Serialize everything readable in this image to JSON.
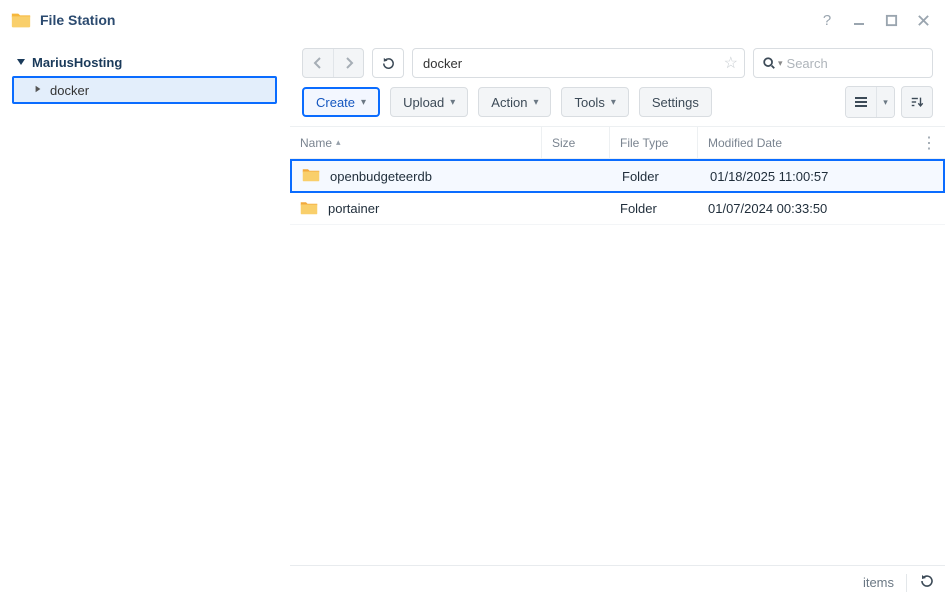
{
  "app": {
    "title": "File Station"
  },
  "sidebar": {
    "root": "MariusHosting",
    "items": [
      {
        "label": "docker",
        "selected": true
      }
    ]
  },
  "path": {
    "value": "docker"
  },
  "search": {
    "placeholder": "Search"
  },
  "toolbar": {
    "create": "Create",
    "upload": "Upload",
    "action": "Action",
    "tools": "Tools",
    "settings": "Settings"
  },
  "columns": {
    "name": "Name",
    "size": "Size",
    "type": "File Type",
    "date": "Modified Date"
  },
  "rows": [
    {
      "name": "openbudgeteerdb",
      "size": "",
      "type": "Folder",
      "date": "01/18/2025 11:00:57",
      "selected": true
    },
    {
      "name": "portainer",
      "size": "",
      "type": "Folder",
      "date": "01/07/2024 00:33:50",
      "selected": false
    }
  ],
  "status": {
    "items_label": "items"
  }
}
